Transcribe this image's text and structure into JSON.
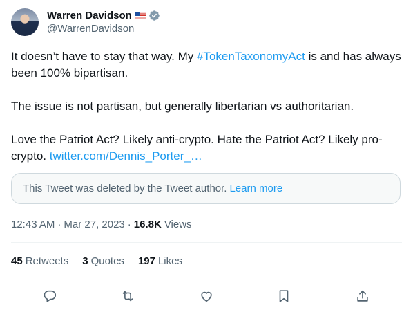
{
  "author": {
    "display_name": "Warren Davidson",
    "handle": "@WarrenDavidson",
    "flag_icon": "us-flag-icon",
    "verified_icon": "verified-badge-icon"
  },
  "tweet": {
    "line1_before": "It doesn’t have to stay that way. My ",
    "hashtag": "#TokenTaxonomyAct",
    "line1_after": " is and has always been 100% bipartisan.",
    "para2": "The issue is not partisan, but generally libertarian vs authoritarian.",
    "para3": "Love the Patriot Act? Likely anti-crypto. Hate the Patriot Act? Likely pro-crypto. ",
    "link": "twitter.com/Dennis_Porter_…"
  },
  "quoted": {
    "text": "This Tweet was deleted by the Tweet author.",
    "learn_more": "Learn more"
  },
  "meta": {
    "time": "12:43 AM",
    "date": "Mar 27, 2023",
    "views_count": "16.8K",
    "views_label": "Views"
  },
  "stats": {
    "retweets_count": "45",
    "retweets_label": "Retweets",
    "quotes_count": "3",
    "quotes_label": "Quotes",
    "likes_count": "197",
    "likes_label": "Likes"
  },
  "colors": {
    "link": "#1d9bf0",
    "muted": "#536471",
    "text": "#0f1419",
    "border": "#cfd9de"
  }
}
